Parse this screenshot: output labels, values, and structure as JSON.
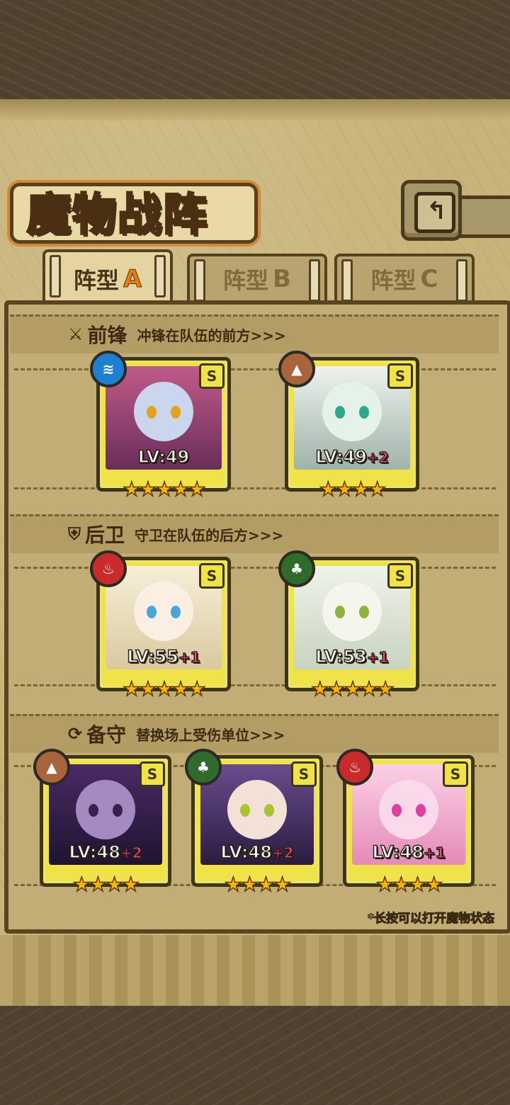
{
  "title": "魔物战阵",
  "tabs": [
    {
      "prefix": "阵型",
      "letter": "A",
      "active": true
    },
    {
      "prefix": "阵型",
      "letter": "B",
      "active": false
    },
    {
      "prefix": "阵型",
      "letter": "C",
      "active": false
    }
  ],
  "sections": {
    "front": {
      "name": "前锋",
      "desc": "冲锋在队伍的前方>>>",
      "icon": "sword-icon"
    },
    "rear": {
      "name": "后卫",
      "desc": "守卫在队伍的后方>>>",
      "icon": "shield-icon"
    },
    "reserve": {
      "name": "备守",
      "desc": "替换场上受伤单位>>>",
      "icon": "swap-icon"
    }
  },
  "units": {
    "front": [
      {
        "level": "LV:49",
        "plus": "",
        "stars": "★★★★★",
        "rank": "S",
        "element": "water",
        "elem_glyph": "≋",
        "elem_color": "#1f7fd1",
        "theme": "#b2457a"
      },
      {
        "level": "LV:49",
        "plus": "+2",
        "stars": "★★★★",
        "rank": "S",
        "element": "earth",
        "elem_glyph": "▲",
        "elem_color": "#a8643a",
        "theme": "#dfe7e3"
      }
    ],
    "rear": [
      {
        "level": "LV:55",
        "plus": "+1",
        "stars": "★★★★★",
        "rank": "S",
        "element": "fire",
        "elem_glyph": "♨",
        "elem_color": "#c92b2b",
        "theme": "#f2e7c9"
      },
      {
        "level": "LV:53",
        "plus": "+1",
        "stars": "★★★★★",
        "rank": "S",
        "element": "wood",
        "elem_glyph": "♣",
        "elem_color": "#2f6b2a",
        "theme": "#e9efe4"
      }
    ],
    "reserve": [
      {
        "level": "LV:48",
        "plus": "+2",
        "stars": "★★★★",
        "rank": "S",
        "element": "earth",
        "elem_glyph": "▲",
        "elem_color": "#a8643a",
        "theme": "#5b2f7c"
      },
      {
        "level": "LV:48",
        "plus": "+2",
        "stars": "★★★★",
        "rank": "S",
        "element": "wood",
        "elem_glyph": "♣",
        "elem_color": "#2f6b2a",
        "theme": "#3a2a5a"
      },
      {
        "level": "LV:48",
        "plus": "+1",
        "stars": "★★★★",
        "rank": "S",
        "element": "fire",
        "elem_glyph": "♨",
        "elem_color": "#c92b2b",
        "theme": "#f5b6d6"
      }
    ]
  },
  "note": "*长按可以打开魔物状态"
}
